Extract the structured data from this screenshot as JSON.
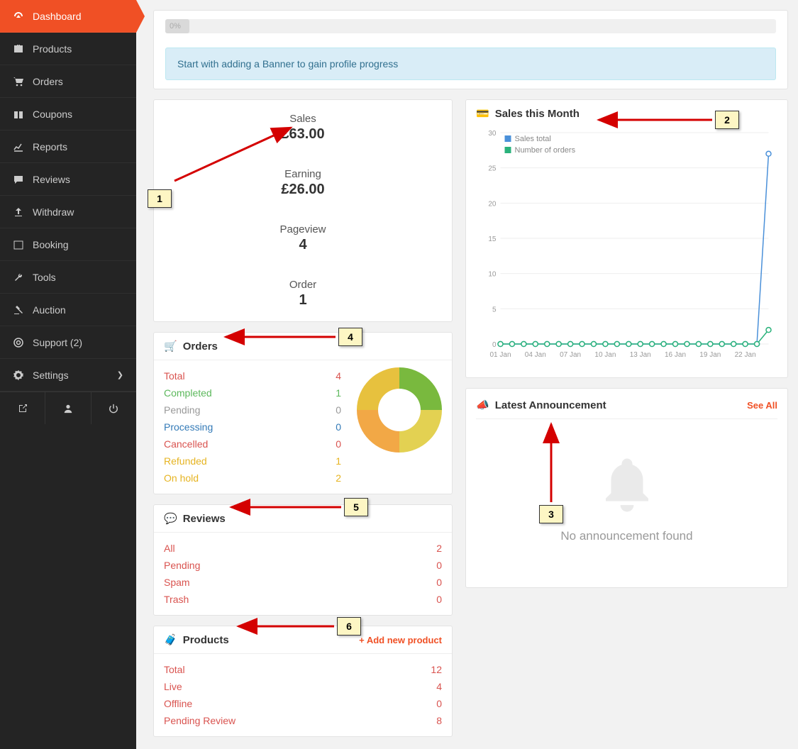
{
  "sidebar": {
    "items": [
      {
        "label": "Dashboard",
        "icon": "dashboard"
      },
      {
        "label": "Products",
        "icon": "briefcase"
      },
      {
        "label": "Orders",
        "icon": "cart"
      },
      {
        "label": "Coupons",
        "icon": "gift"
      },
      {
        "label": "Reports",
        "icon": "chart"
      },
      {
        "label": "Reviews",
        "icon": "comment"
      },
      {
        "label": "Withdraw",
        "icon": "upload"
      },
      {
        "label": "Booking",
        "icon": "calendar"
      },
      {
        "label": "Tools",
        "icon": "wrench"
      },
      {
        "label": "Auction",
        "icon": "gavel"
      },
      {
        "label": "Support (2)",
        "icon": "life-ring"
      },
      {
        "label": "Settings",
        "icon": "gear",
        "chev": true
      }
    ]
  },
  "progress": {
    "text": "0%",
    "width": "4%"
  },
  "banner": {
    "text": "Start with adding a Banner to gain profile progress"
  },
  "stats": {
    "sales": {
      "label": "Sales",
      "value": "£63.00"
    },
    "earning": {
      "label": "Earning",
      "value": "£26.00"
    },
    "pageview": {
      "label": "Pageview",
      "value": "4"
    },
    "order": {
      "label": "Order",
      "value": "1"
    }
  },
  "orders_card": {
    "title": "Orders",
    "rows": [
      {
        "label": "Total",
        "value": "4",
        "cls": "c-red"
      },
      {
        "label": "Completed",
        "value": "1",
        "cls": "c-green"
      },
      {
        "label": "Pending",
        "value": "0",
        "cls": "c-grey"
      },
      {
        "label": "Processing",
        "value": "0",
        "cls": "c-blue"
      },
      {
        "label": "Cancelled",
        "value": "0",
        "cls": "c-red"
      },
      {
        "label": "Refunded",
        "value": "1",
        "cls": "c-amber"
      },
      {
        "label": "On hold",
        "value": "2",
        "cls": "c-amber"
      }
    ]
  },
  "reviews_card": {
    "title": "Reviews",
    "rows": [
      {
        "label": "All",
        "value": "2",
        "cls": "c-red"
      },
      {
        "label": "Pending",
        "value": "0",
        "cls": "c-red"
      },
      {
        "label": "Spam",
        "value": "0",
        "cls": "c-red"
      },
      {
        "label": "Trash",
        "value": "0",
        "cls": "c-red"
      }
    ]
  },
  "products_card": {
    "title": "Products",
    "add_link": "+ Add new product",
    "rows": [
      {
        "label": "Total",
        "value": "12",
        "cls": "c-red"
      },
      {
        "label": "Live",
        "value": "4",
        "cls": "c-red"
      },
      {
        "label": "Offline",
        "value": "0",
        "cls": "c-red"
      },
      {
        "label": "Pending Review",
        "value": "8",
        "cls": "c-red"
      }
    ]
  },
  "sales_chart": {
    "title": "Sales this Month"
  },
  "announcement": {
    "title": "Latest Announcement",
    "link": "See All",
    "empty": "No announcement found"
  },
  "callouts": [
    "1",
    "2",
    "3",
    "4",
    "5",
    "6"
  ],
  "chart_data": {
    "type": "line",
    "title": "Sales this Month",
    "ylim": [
      0,
      30
    ],
    "x_ticks": [
      "01 Jan",
      "04 Jan",
      "07 Jan",
      "10 Jan",
      "13 Jan",
      "16 Jan",
      "19 Jan",
      "22 Jan"
    ],
    "y_ticks": [
      0,
      5,
      10,
      15,
      20,
      25,
      30
    ],
    "legend": [
      "Sales total",
      "Number of orders"
    ],
    "series": [
      {
        "name": "Sales total",
        "color": "#4a90d9",
        "values": [
          0,
          0,
          0,
          0,
          0,
          0,
          0,
          0,
          0,
          0,
          0,
          0,
          0,
          0,
          0,
          0,
          0,
          0,
          0,
          0,
          0,
          0,
          0,
          27
        ]
      },
      {
        "name": "Number of orders",
        "color": "#2ab27b",
        "values": [
          0,
          0,
          0,
          0,
          0,
          0,
          0,
          0,
          0,
          0,
          0,
          0,
          0,
          0,
          0,
          0,
          0,
          0,
          0,
          0,
          0,
          0,
          0,
          2
        ]
      }
    ]
  }
}
